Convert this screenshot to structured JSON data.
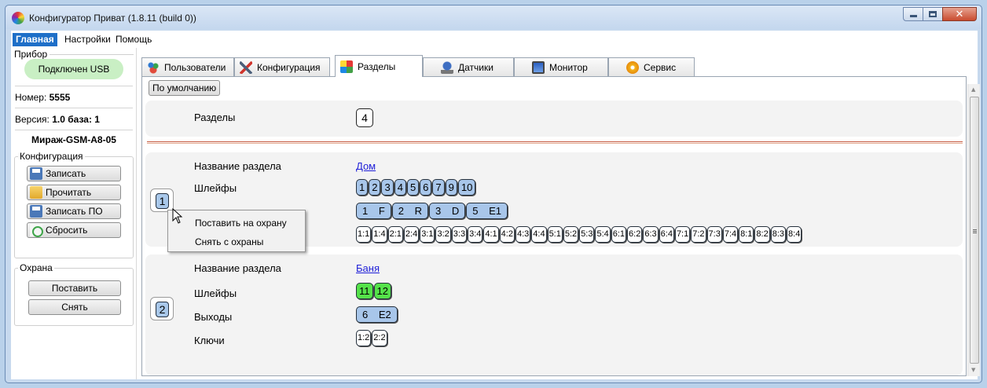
{
  "window": {
    "title": "Конфигуратор Приват (1.8.11 (build 0))"
  },
  "menu": [
    "Главная",
    "Настройки",
    "Помощь"
  ],
  "sidebar": {
    "device_group": "Прибор",
    "usb_status": "Подключен USB",
    "number_label": "Номер:",
    "number_value": "5555",
    "version_label": "Версия:",
    "version_value": "1.0 база: 1",
    "device_name": "Мираж-GSM-A8-05",
    "config_group": "Конфигурация",
    "config_buttons": [
      "Записать",
      "Прочитать",
      "Записать ПО",
      "Сбросить"
    ],
    "guard_group": "Охрана",
    "guard_buttons": [
      "Поставить",
      "Снять"
    ]
  },
  "tabs": [
    {
      "label": "Пользователи",
      "icon": "users-icon"
    },
    {
      "label": "Конфигурация",
      "icon": "tools-icon"
    },
    {
      "label": "Разделы",
      "icon": "partitions-icon",
      "active": true
    },
    {
      "label": "Датчики",
      "icon": "sensor-icon"
    },
    {
      "label": "Монитор",
      "icon": "monitor-icon"
    },
    {
      "label": "Сервис",
      "icon": "service-icon"
    }
  ],
  "toolbar": {
    "default_button": "По умолчанию"
  },
  "partitions_header": {
    "label": "Разделы",
    "count": "4"
  },
  "partition1": {
    "number": "1",
    "name_label": "Название раздела",
    "name_value": "Дом",
    "loops_label": "Шлейфы",
    "loops": [
      "1",
      "2",
      "3",
      "4",
      "5",
      "6",
      "7",
      "9",
      "10"
    ],
    "outputs": [
      "1 F",
      "2 R",
      "3 D",
      "5 E1"
    ],
    "keys": [
      "1:1",
      "1:4",
      "2:1",
      "2:4",
      "3:1",
      "3:2",
      "3:3",
      "3:4",
      "4:1",
      "4:2",
      "4:3",
      "4:4",
      "5:1",
      "5:2",
      "5:3",
      "5:4",
      "6:1",
      "6:2",
      "6:3",
      "6:4",
      "7:1",
      "7:2",
      "7:3",
      "7:4",
      "8:1",
      "8:2",
      "8:3",
      "8:4"
    ]
  },
  "partition2": {
    "number": "2",
    "name_label": "Название раздела",
    "name_value": "Баня",
    "loops_label": "Шлейфы",
    "loops": [
      "11",
      "12"
    ],
    "outputs_label": "Выходы",
    "outputs": [
      "6 E2"
    ],
    "keys_label": "Ключи",
    "keys": [
      "1:2",
      "2:2"
    ]
  },
  "context_menu": [
    "Поставить на охрану",
    "Снять с охраны"
  ],
  "colors": {
    "loop_armed": "#55e24a",
    "loop_chip": "#a8c6ea",
    "menu_active": "#1e6fc8",
    "divider": "#c4563b"
  }
}
